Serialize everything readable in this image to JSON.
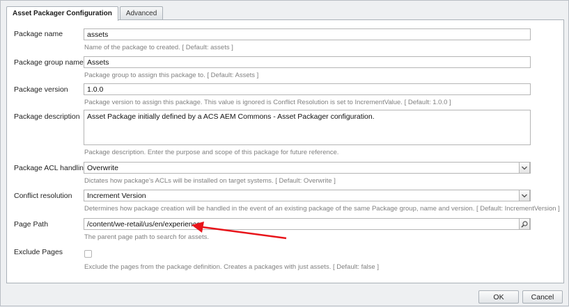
{
  "tabs": [
    {
      "label": "Asset Packager Configuration"
    },
    {
      "label": "Advanced"
    }
  ],
  "form": {
    "package_name": {
      "label": "Package name",
      "value": "assets",
      "hint": "Name of the package to created. [ Default: assets ]"
    },
    "package_group": {
      "label": "Package group name",
      "value": "Assets",
      "hint": "Package group to assign this package to. [ Default: Assets ]"
    },
    "package_version": {
      "label": "Package version",
      "value": "1.0.0",
      "hint": "Package version to assign this package. This value is ignored is Conflict Resolution is set to IncrementValue. [ Default: 1.0.0 ]"
    },
    "package_description": {
      "label": "Package description",
      "value": "Asset Package initially defined by a ACS AEM Commons - Asset Packager configuration.",
      "hint": "Package description. Enter the purpose and scope of this package for future reference."
    },
    "acl_handling": {
      "label": "Package ACL handling",
      "value": "Overwrite",
      "hint": "Dictates how package's ACLs will be installed on target systems. [ Default: Overwrite ]"
    },
    "conflict_resolution": {
      "label": "Conflict resolution",
      "value": "Increment Version",
      "hint": "Determines how package creation will be handled in the event of an existing package of the same Package group, name and version. [ Default: IncrementVersion ]"
    },
    "page_path": {
      "label": "Page Path",
      "value": "/content/we-retail/us/en/experience",
      "hint": "The parent page path to search for assets."
    },
    "exclude_pages": {
      "label": "Exclude Pages",
      "checked": false,
      "hint": "Exclude the pages from the package definition. Creates a packages with just assets. [ Default: false ]"
    }
  },
  "footer": {
    "ok_label": "OK",
    "cancel_label": "Cancel"
  },
  "icons": {
    "select_arrow": "chevron-down-icon",
    "search": "magnifier-icon"
  },
  "colors": {
    "annotation_arrow": "#e8141a"
  }
}
